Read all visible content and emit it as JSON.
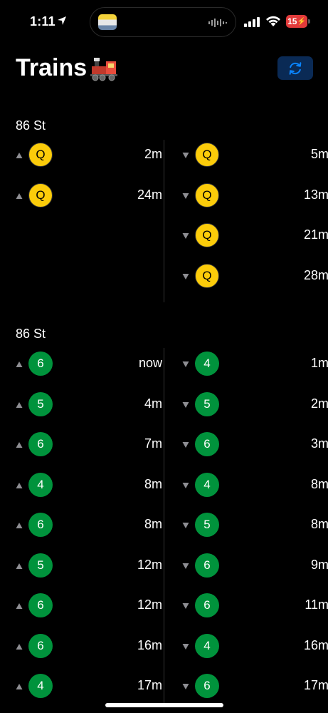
{
  "status_bar": {
    "time": "1:11",
    "battery": "15"
  },
  "header": {
    "title": "Trains"
  },
  "stations": [
    {
      "name": "86 St",
      "uptown": [
        {
          "line": "Q",
          "color": "#fccc0a",
          "time": "2m"
        },
        {
          "line": "Q",
          "color": "#fccc0a",
          "time": "24m"
        }
      ],
      "downtown": [
        {
          "line": "Q",
          "color": "#fccc0a",
          "time": "5m"
        },
        {
          "line": "Q",
          "color": "#fccc0a",
          "time": "13m"
        },
        {
          "line": "Q",
          "color": "#fccc0a",
          "time": "21m"
        },
        {
          "line": "Q",
          "color": "#fccc0a",
          "time": "28m"
        }
      ]
    },
    {
      "name": "86 St",
      "uptown": [
        {
          "line": "6",
          "color": "#00933c",
          "time": "now"
        },
        {
          "line": "5",
          "color": "#00933c",
          "time": "4m"
        },
        {
          "line": "6",
          "color": "#00933c",
          "time": "7m"
        },
        {
          "line": "4",
          "color": "#00933c",
          "time": "8m"
        },
        {
          "line": "6",
          "color": "#00933c",
          "time": "8m"
        },
        {
          "line": "5",
          "color": "#00933c",
          "time": "12m"
        },
        {
          "line": "6",
          "color": "#00933c",
          "time": "12m"
        },
        {
          "line": "6",
          "color": "#00933c",
          "time": "16m"
        },
        {
          "line": "4",
          "color": "#00933c",
          "time": "17m"
        }
      ],
      "downtown": [
        {
          "line": "4",
          "color": "#00933c",
          "time": "1m"
        },
        {
          "line": "5",
          "color": "#00933c",
          "time": "2m"
        },
        {
          "line": "6",
          "color": "#00933c",
          "time": "3m"
        },
        {
          "line": "4",
          "color": "#00933c",
          "time": "8m"
        },
        {
          "line": "5",
          "color": "#00933c",
          "time": "8m"
        },
        {
          "line": "6",
          "color": "#00933c",
          "time": "9m"
        },
        {
          "line": "6",
          "color": "#00933c",
          "time": "11m"
        },
        {
          "line": "4",
          "color": "#00933c",
          "time": "16m"
        },
        {
          "line": "6",
          "color": "#00933c",
          "time": "17m"
        }
      ]
    }
  ],
  "colors": {
    "accent": "#0a84ff",
    "refresh_bg": "#0a2a55"
  }
}
